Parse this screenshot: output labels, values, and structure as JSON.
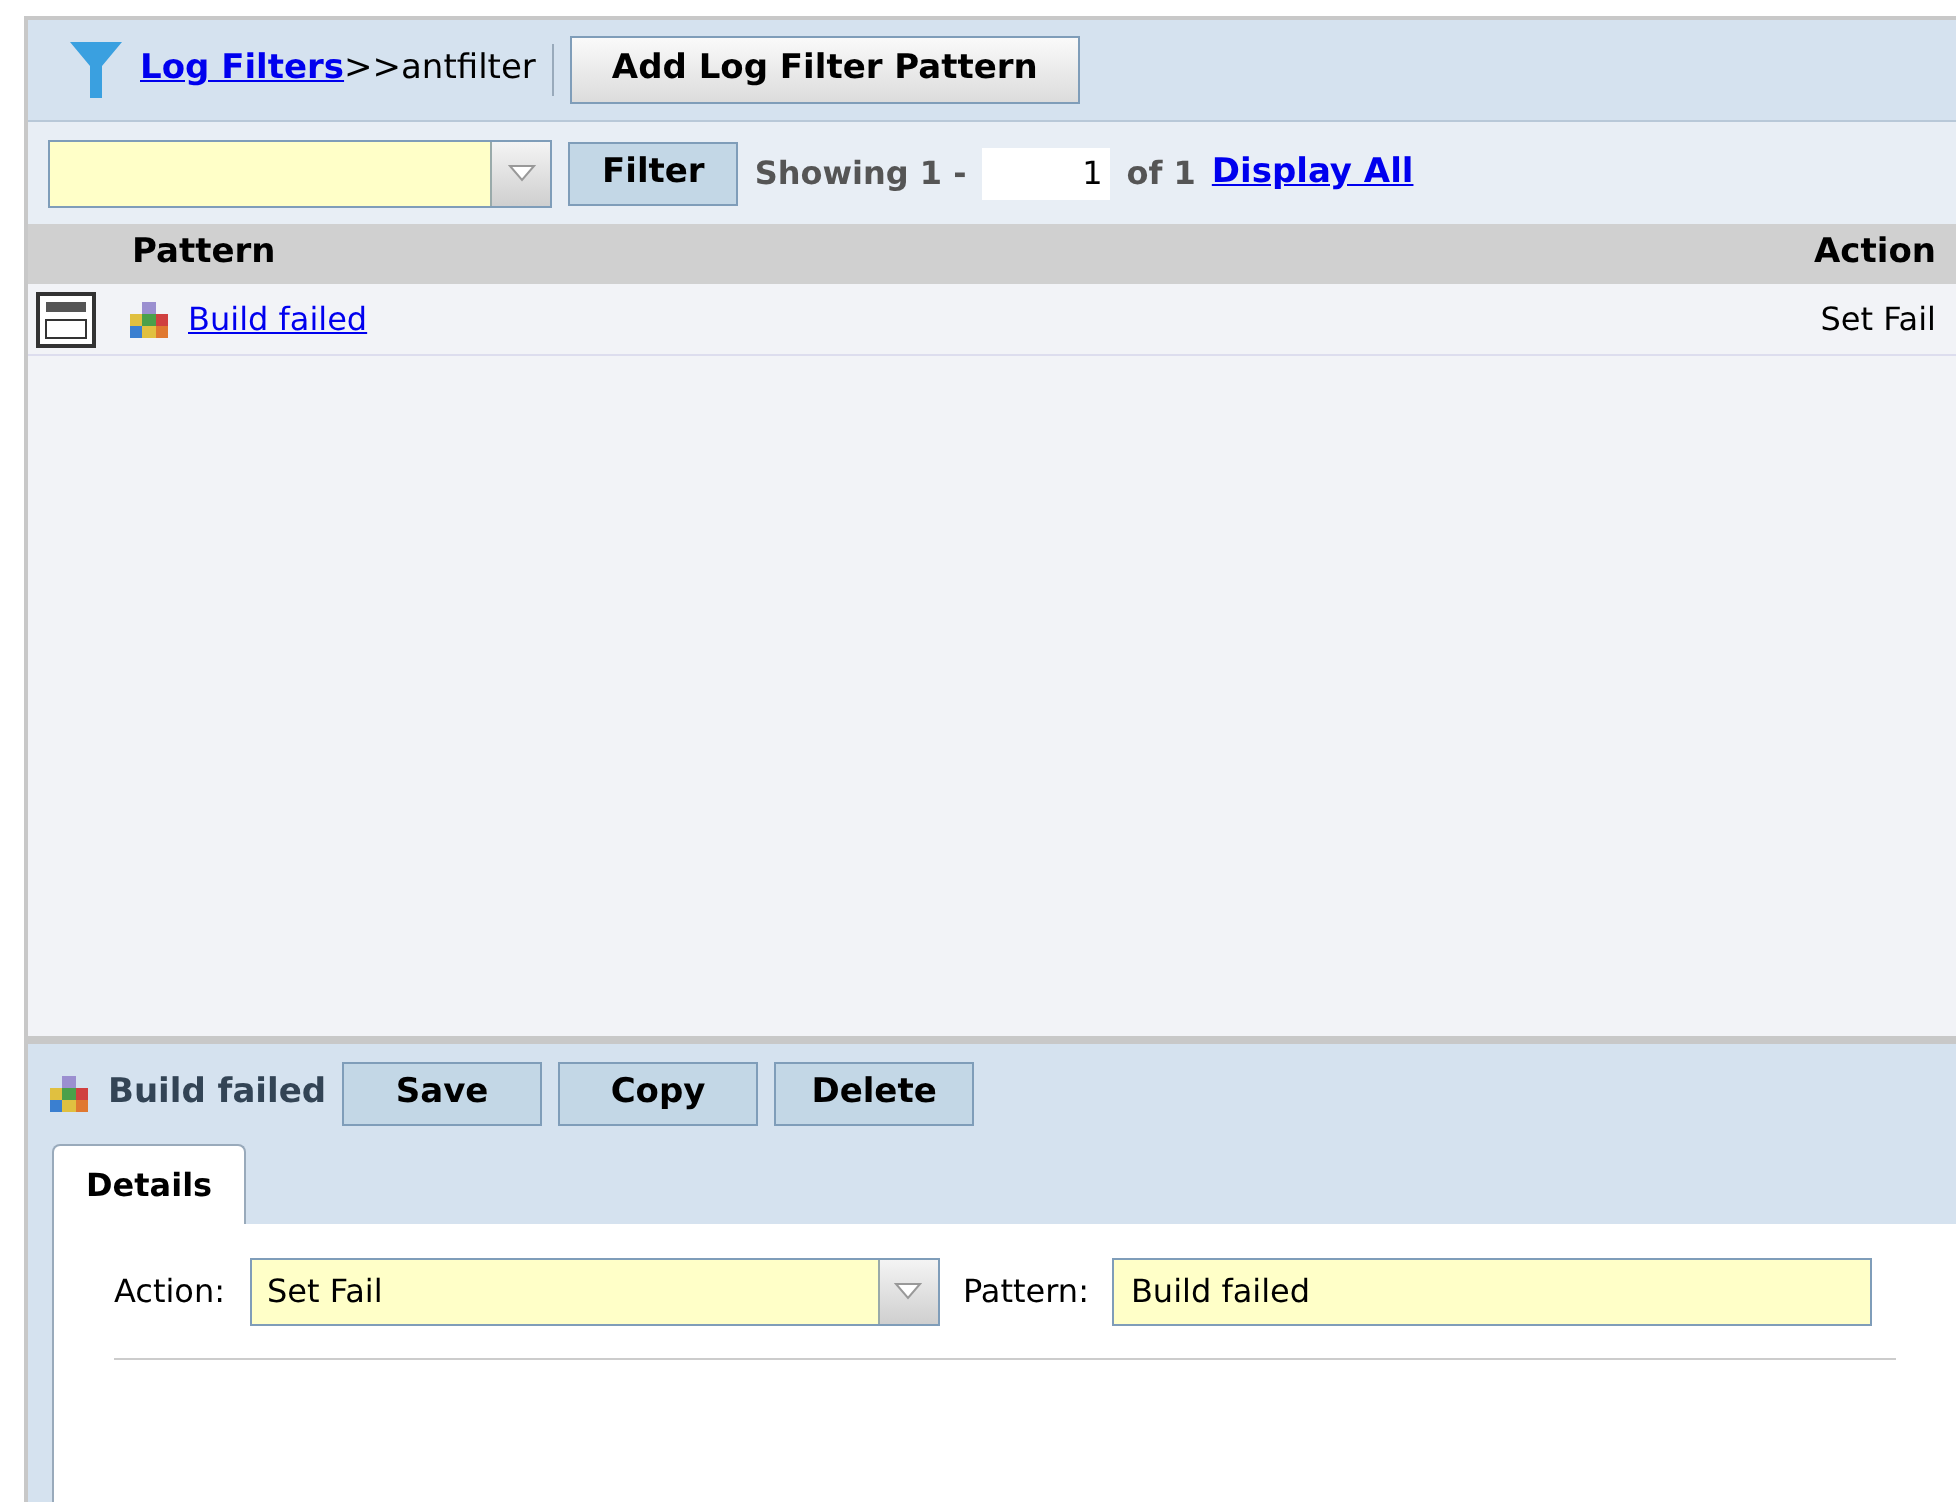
{
  "breadcrumb": {
    "link": "Log Filters",
    "current": ">>antfilter"
  },
  "toolbar": {
    "add_button": "Add Log Filter Pattern"
  },
  "filter_bar": {
    "filter_button": "Filter",
    "showing_label": "Showing 1 -",
    "page_value": "1",
    "of_label": "of 1",
    "display_all": "Display All"
  },
  "table": {
    "columns": [
      "Pattern",
      "Action"
    ],
    "rows": [
      {
        "pattern": "Build failed",
        "action": "Set Fail"
      }
    ]
  },
  "detail": {
    "title": "Build failed",
    "buttons": [
      "Save",
      "Copy",
      "Delete"
    ],
    "tabs": [
      {
        "label": "Details",
        "selected": true
      }
    ],
    "fields": [
      {
        "kind": "select",
        "label": "Action:",
        "value": "Set Fail"
      },
      {
        "kind": "text",
        "label": "Pattern:",
        "value": "Build failed"
      }
    ]
  }
}
